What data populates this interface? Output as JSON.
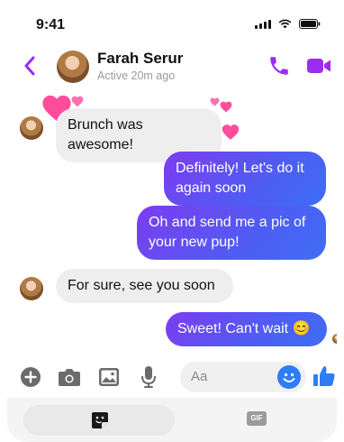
{
  "status_bar": {
    "time": "9:41"
  },
  "contact": {
    "name": "Farah Serur",
    "active_status": "Active 20m ago"
  },
  "messages": [
    {
      "direction": "incoming",
      "text": "Brunch was awesome!"
    },
    {
      "direction": "outgoing",
      "text": "Definitely! Let's do it again soon"
    },
    {
      "direction": "outgoing",
      "text": "Oh and send me a pic of your new pup!"
    },
    {
      "direction": "incoming",
      "text": "For sure, see you soon"
    },
    {
      "direction": "outgoing",
      "text": "Sweet! Can't wait 😊"
    }
  ],
  "composer": {
    "placeholder": "Aa"
  },
  "bottom_tabs": {
    "gif_label": "GIF"
  },
  "colors": {
    "accent_purple": "#9b2cf0",
    "bubble_gradient_start": "#7d3cf0",
    "bubble_gradient_end": "#3d6ef5",
    "composer_blue": "#2e7df6",
    "heart_pink": "#ff4d9a"
  },
  "icons": [
    "back-chevron-icon",
    "phone-icon",
    "video-camera-icon",
    "add-icon",
    "camera-icon",
    "image-icon",
    "microphone-icon",
    "emoji-icon",
    "thumbs-up-icon",
    "sticker-icon",
    "gif-icon",
    "heart-icon"
  ]
}
